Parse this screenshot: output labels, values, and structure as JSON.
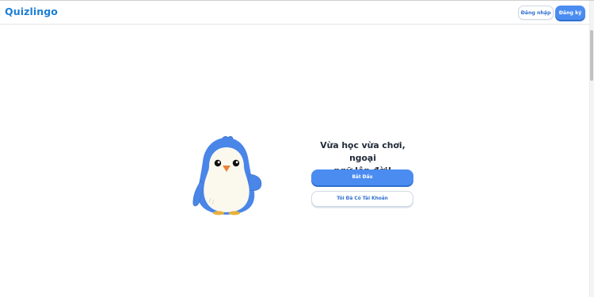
{
  "header": {
    "logo": "Quizlingo",
    "login_label": "Đăng nhập",
    "register_label": "Đăng ký"
  },
  "hero": {
    "heading_line1": "Vừa học vừa chơi, ngoại",
    "heading_line2": "ngữ lên đời!",
    "start_label": "Bắt Đầu",
    "have_account_label": "Tôi Đã Có Tài Khoản"
  },
  "colors": {
    "brand": "#1c7ed6",
    "primary_button": "#4b8cf1",
    "mascot_blue": "#4a86e8"
  },
  "icons": {
    "mascot": "penguin-mascot"
  }
}
